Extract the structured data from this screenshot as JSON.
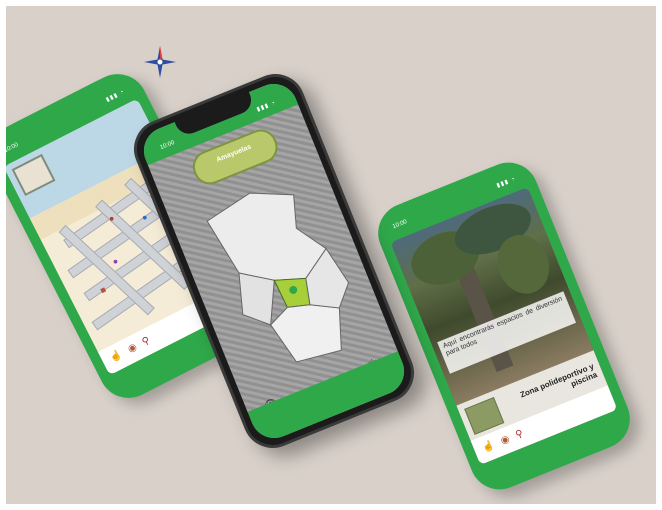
{
  "phones": {
    "left": {
      "time": "10:00"
    },
    "middle": {
      "time": "10:00",
      "logo": "Amayuelas"
    },
    "right": {
      "time": "10:00",
      "caption": "Aquí encontrarás espacios de diversión para todos",
      "place_title": "Zona polideportivo y piscina"
    }
  },
  "icons": {
    "compass": "compass-rose",
    "home": "hand-icon",
    "menu": "circle-icon",
    "location": "pin-icon",
    "eye": "eye-icon",
    "star": "star-icon",
    "bike": "bike-icon"
  },
  "colors": {
    "brand_green": "#2fa84a",
    "background": "#d8d0c9"
  }
}
